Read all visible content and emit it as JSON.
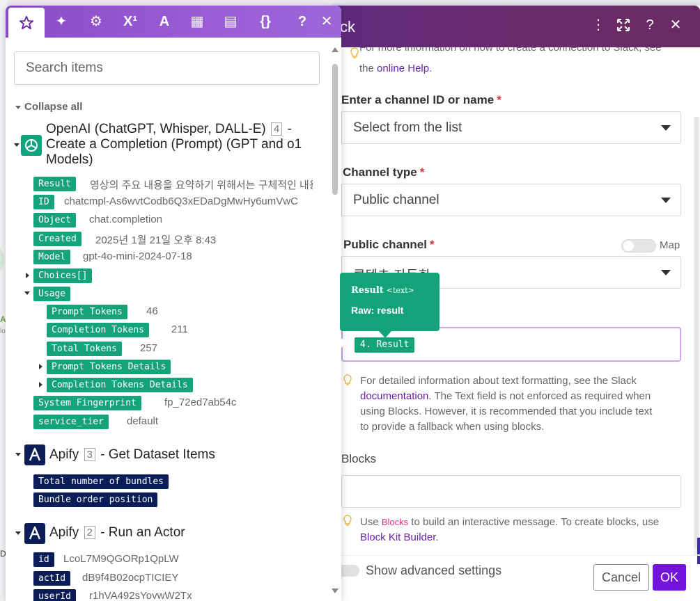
{
  "dialog": {
    "title_fragment": "ck",
    "header_icons": [
      "more-vertical-icon",
      "expand-icon",
      "help-icon",
      "close-icon"
    ],
    "connection_help": {
      "line1": "For more information on how to create a connection to Slack, see",
      "line2_prefix": "the ",
      "link": "online Help",
      "line2_suffix": "."
    },
    "channel_id": {
      "label": "Enter a channel ID or name",
      "value": "Select from the list"
    },
    "channel_type": {
      "label": "Channel type",
      "value": "Public channel"
    },
    "public_channel": {
      "label": "Public channel",
      "map_label": "Map",
      "value": "콘텐츠-자동화"
    },
    "text_field": {
      "token": "4. Result"
    },
    "text_help": {
      "line1": "For detailed information about text formatting, see the Slack",
      "link": "documentation",
      "line2_rest": ". The Text field is not enforced as required when",
      "line3": "using Blocks. However, it is recommended that you include text",
      "line4": "to provide a fallback when using blocks."
    },
    "blocks": {
      "label": "Blocks",
      "help_prefix": "Use ",
      "help_code": "Blocks",
      "help_mid": " to build an interactive message. To create blocks, use",
      "help_link": "Block Kit Builder",
      "help_suffix": "."
    },
    "footer": {
      "advanced": "Show advanced settings",
      "cancel": "Cancel",
      "ok": "OK"
    }
  },
  "tooltip": {
    "title": "Result",
    "type": "<text>",
    "raw": "Raw: result"
  },
  "panel": {
    "tabs": [
      {
        "icon": "star-icon",
        "glyph": "☆"
      },
      {
        "icon": "sparkles-icon",
        "glyph": "✦"
      },
      {
        "icon": "gear-icon",
        "glyph": "⚙"
      },
      {
        "icon": "superscript-icon",
        "glyph": "X¹"
      },
      {
        "icon": "text-format-icon",
        "glyph": "A"
      },
      {
        "icon": "calendar-icon",
        "glyph": "▦"
      },
      {
        "icon": "table-icon",
        "glyph": "▤"
      },
      {
        "icon": "braces-icon",
        "glyph": "{}"
      },
      {
        "icon": "help-icon",
        "glyph": "?"
      },
      {
        "icon": "close-icon",
        "glyph": "✕"
      }
    ],
    "search_placeholder": "Search items",
    "collapse_all": "Collapse all",
    "openai": {
      "line1": "OpenAI (ChatGPT, Whisper, DALL-E)",
      "badge": "4",
      "line1_suffix": "-",
      "line2": "Create a Completion (Prompt) (GPT and o1",
      "line3": "Models)",
      "items": [
        {
          "key": "Result",
          "value": "영상의 주요 내용을 요약하기 위해서는 구체적인 내용"
        },
        {
          "key": "ID",
          "value": "chatcmpl-As6wvtCodb6Q3xEDaDgMwHy6umVwC"
        },
        {
          "key": "Object",
          "value": "chat.completion"
        },
        {
          "key": "Created",
          "value": "2025년 1월 21일 오후 8:43"
        },
        {
          "key": "Model",
          "value": "gpt-4o-mini-2024-07-18"
        },
        {
          "key": "Choices[]",
          "value": ""
        },
        {
          "key": "Usage",
          "value": ""
        },
        {
          "key": "Prompt Tokens",
          "value": "46"
        },
        {
          "key": "Completion Tokens",
          "value": "211"
        },
        {
          "key": "Total Tokens",
          "value": "257"
        },
        {
          "key": "Prompt Tokens Details",
          "value": ""
        },
        {
          "key": "Completion Tokens Details",
          "value": ""
        },
        {
          "key": "System Fingerprint",
          "value": "fp_72ed7ab54c"
        },
        {
          "key": "service_tier",
          "value": "default"
        }
      ]
    },
    "apify3": {
      "name": "Apify",
      "badge": "3",
      "title": "- Get Dataset Items",
      "items": [
        {
          "key": "Total number of bundles"
        },
        {
          "key": "Bundle order position"
        }
      ]
    },
    "apify2": {
      "name": "Apify",
      "badge": "2",
      "title": "- Run an Actor",
      "items": [
        {
          "key": "id",
          "value": "LcoL7M9QGORp1QpLW"
        },
        {
          "key": "actId",
          "value": "dB9f4B02ocpTICIEY"
        },
        {
          "key": "userId",
          "value": "r1hVA492sYovwW2Tx"
        }
      ]
    }
  },
  "colors": {
    "accent": "#7413dc",
    "pill_green": "#15a37a",
    "pill_navy": "#0a1d56",
    "header": "#5f2a7d"
  }
}
